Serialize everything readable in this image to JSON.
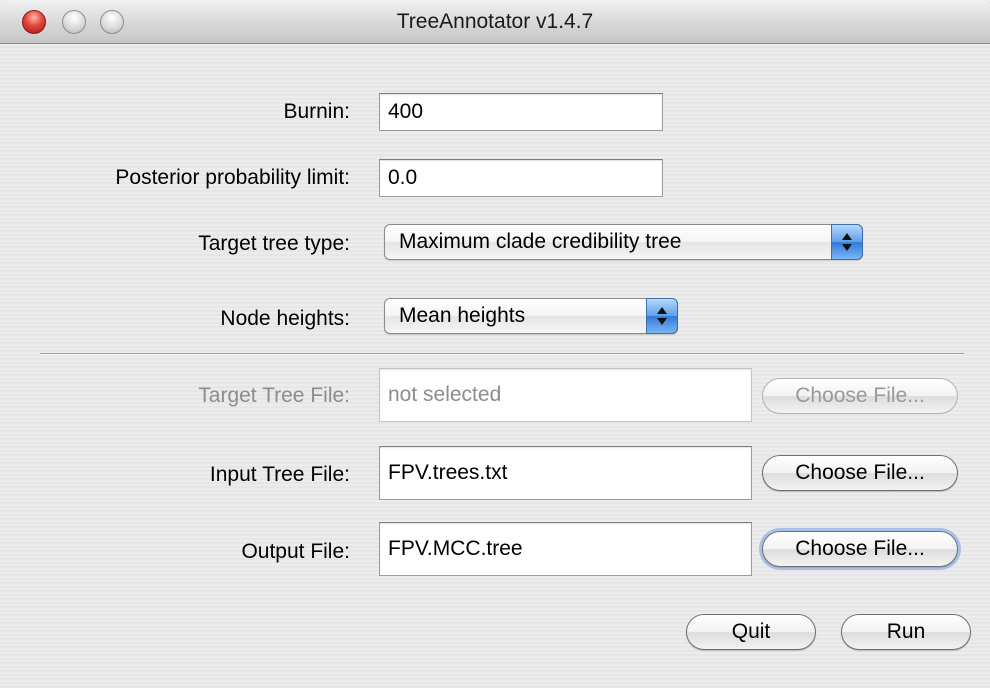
{
  "window": {
    "title": "TreeAnnotator v1.4.7"
  },
  "form": {
    "burnin": {
      "label": "Burnin:",
      "value": "400"
    },
    "posterior_limit": {
      "label": "Posterior probability limit:",
      "value": "0.0"
    },
    "target_tree_type": {
      "label": "Target tree type:",
      "selected": "Maximum clade credibility tree"
    },
    "node_heights": {
      "label": "Node heights:",
      "selected": "Mean heights"
    },
    "target_tree_file": {
      "label": "Target Tree File:",
      "value": "not selected",
      "button": "Choose File...",
      "enabled": false
    },
    "input_tree_file": {
      "label": "Input Tree File:",
      "value": "FPV.trees.txt",
      "button": "Choose File..."
    },
    "output_file": {
      "label": "Output File:",
      "value": "FPV.MCC.tree",
      "button": "Choose File..."
    }
  },
  "actions": {
    "quit": "Quit",
    "run": "Run"
  },
  "icons": {
    "close": "close-button-icon",
    "minimize": "minimize-button-icon",
    "zoom": "zoom-button-icon",
    "popup_arrows": "updown-chevron-icon"
  },
  "colors": {
    "close_red": "#e3463a",
    "popup_blue": "#5d9ee8"
  }
}
